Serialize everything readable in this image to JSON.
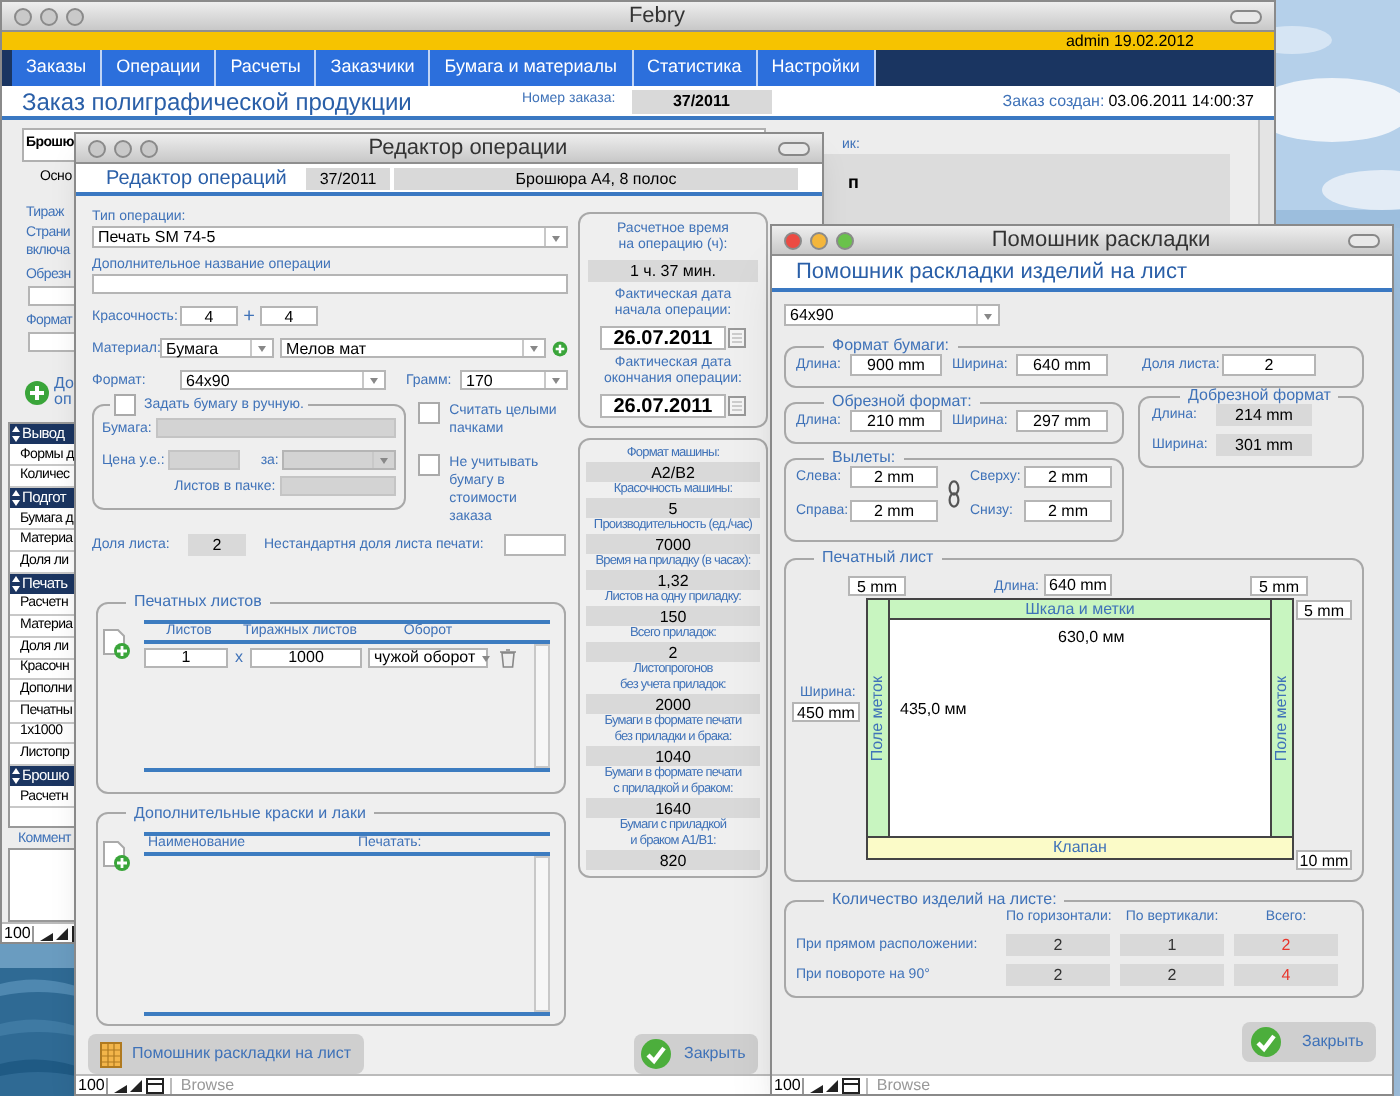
{
  "main_window": {
    "title": "Febry",
    "active": false,
    "user_date": "admin 19.02.2012",
    "nav": [
      {
        "label": "Заказы",
        "selected": false
      },
      {
        "label": "Операции",
        "selected": false
      },
      {
        "label": "Расчеты",
        "selected": false
      },
      {
        "label": "Заказчики",
        "selected": false
      },
      {
        "label": "Бумага и материалы",
        "selected": false
      },
      {
        "label": "Статистика",
        "selected": false
      },
      {
        "label": "Настройки",
        "selected": false
      }
    ],
    "page_title": "Заказ полиграфической продукции",
    "order_label": "Номер заказа:",
    "order_number": "37/2011",
    "created_label": "Заказ создан:",
    "created_value": "03.06.2011 14:00:37",
    "product": "Брошю",
    "tab": "Осно",
    "labels": [
      "Тираж",
      "Страни",
      "включа",
      "Обрезн",
      "Формат"
    ],
    "add_label_lines": [
      "До",
      "оп"
    ],
    "list": [
      {
        "kind": "header",
        "text": "Вывод"
      },
      {
        "kind": "row",
        "text": "Формы д"
      },
      {
        "kind": "row",
        "text": "Количес"
      },
      {
        "kind": "header",
        "text": "Подгот"
      },
      {
        "kind": "row",
        "text": "Бумага д"
      },
      {
        "kind": "row",
        "text": "Материа"
      },
      {
        "kind": "row",
        "text": "Доля ли"
      },
      {
        "kind": "header",
        "text": "Печать"
      },
      {
        "kind": "row",
        "text": "Расчетн"
      },
      {
        "kind": "row",
        "text": "Материа"
      },
      {
        "kind": "row",
        "text": "Доля ли"
      },
      {
        "kind": "row",
        "text": "Красочн"
      },
      {
        "kind": "row",
        "text": "Дополни"
      },
      {
        "kind": "row",
        "text": "Печатны"
      },
      {
        "kind": "row",
        "text": "1x1000"
      },
      {
        "kind": "row",
        "text": "Листопр"
      },
      {
        "kind": "header",
        "text": "Брошю"
      },
      {
        "kind": "row",
        "text": "Расчетн"
      }
    ],
    "comment_label": "Коммент",
    "right_label": "ик:",
    "right_value": "п",
    "zoom": "100"
  },
  "operation_editor": {
    "title": "Редактор операции",
    "active": false,
    "heading": "Редактор операций",
    "order_number": "37/2011",
    "product": "Брошюра А4,  8 полос",
    "operation_type": {
      "label": "Тип операции:",
      "value": "Печать SM 74-5"
    },
    "extra_name": {
      "label": "Дополнительное название операции"
    },
    "colors": {
      "label": "Красочность:",
      "front": "4",
      "plus": "+",
      "back": "4"
    },
    "material": {
      "label": "Материал:",
      "type": "Бумага",
      "value": "Мелов мат"
    },
    "format": {
      "label": "Формат:",
      "value": "64x90"
    },
    "grams": {
      "label": "Грамм:",
      "value": "170"
    },
    "manual_paper": {
      "label": "Задать бумагу в ручную.",
      "checked": false,
      "paper_label": "Бумага:",
      "price_label": "Цена у.е.:",
      "per_label": "за:",
      "pack_label": "Листов в пачке:"
    },
    "options": [
      {
        "label": "Считать целыми пачками",
        "checked": false
      },
      {
        "label": "Не учитывать бумагу в стоимости заказа",
        "checked": false
      }
    ],
    "sheet_share": {
      "label": "Доля листа:",
      "value": "2"
    },
    "custom_share": {
      "label": "Нестандартня доля листа печати:"
    },
    "print_sheets": {
      "title": "Печатных листов",
      "columns": [
        "Листов",
        "Тиражных листов",
        "Оборот"
      ],
      "rows": [
        {
          "sheets": "1",
          "times": "x",
          "run": "1000",
          "turn": "чужой оборот"
        }
      ]
    },
    "extra_inks": {
      "title": "Дополнительные краски и лаки",
      "columns": [
        "Наименование",
        "Печатать:"
      ]
    },
    "timing": [
      {
        "kind": "readout",
        "label": "Расчетное время\nна операцию (ч):",
        "value": "1 ч. 37 мин."
      },
      {
        "kind": "date",
        "label": "Фактическая дата\nначала операции:",
        "value": "26.07.2011"
      },
      {
        "kind": "date",
        "label": "Фактическая дата\nокончания операции:",
        "value": "26.07.2011"
      }
    ],
    "machine": [
      {
        "label": "Формат машины:",
        "value": "A2/B2"
      },
      {
        "label": "Красочность машины:",
        "value": "5"
      },
      {
        "label": "Производительность (ед./час)",
        "value": "7000"
      },
      {
        "label": "Время на приладку (в часах):",
        "value": "1,32"
      },
      {
        "label": "Листов на одну приладку:",
        "value": "150"
      },
      {
        "label": "Всего приладок:",
        "value": "2"
      },
      {
        "label": "Листопрогонов\nбез учета приладок:",
        "value": "2000"
      },
      {
        "label": "Бумаги в формате печати\nбез приладки и брака:",
        "value": "1040"
      },
      {
        "label": "Бумаги в формате печати\nс приладкой и браком:",
        "value": "1640"
      },
      {
        "label": "Бумаги с приладкой\nи браком A1/B1:",
        "value": "820"
      }
    ],
    "layout_button": "Помошник раскладки на лист",
    "close_button": "Закрыть",
    "zoom": "100",
    "mode": "Browse"
  },
  "layout_helper": {
    "title": "Помошник раскладки",
    "active": true,
    "heading": "Помошник раскладки изделий на лист",
    "format": "64x90",
    "paper_format": {
      "title": "Формат бумаги:",
      "length_label": "Длина:",
      "length": "900 mm",
      "width_label": "Ширина:",
      "width": "640 mm",
      "share_label": "Доля листа:",
      "share": "2"
    },
    "trim_format": {
      "title": "Обрезной формат:",
      "length_label": "Длина:",
      "length": "210 mm",
      "width_label": "Ширина:",
      "width": "297 mm"
    },
    "pre_trim_format": {
      "title": "Добрезной формат",
      "length_label": "Длина:",
      "length": "214 mm",
      "width_label": "Ширина:",
      "width": "301 mm"
    },
    "bleeds": {
      "title": "Вылеты:",
      "left_label": "Слева:",
      "left": "2 mm",
      "right_label": "Справа:",
      "right": "2 mm",
      "top_label": "Сверху:",
      "top": "2 mm",
      "bottom_label": "Снизу:",
      "bottom": "2 mm"
    },
    "print_sheet": {
      "title": "Печатный лист",
      "margin_left": "5 mm",
      "length_label": "Длина:",
      "length": "640 mm",
      "margin_right": "5 mm",
      "margin_top": "5 mm",
      "width_label": "Ширина:",
      "width": "450 mm",
      "margin_bottom": "10 mm",
      "top_strip": "Шкала и метки",
      "left_strip": "Поле меток",
      "right_strip": "Поле меток",
      "bottom_strip": "Клапан",
      "area_width": "630,0 мм",
      "area_height": "435,0 мм"
    },
    "count": {
      "title": "Количество изделий на листе:",
      "columns": [
        "По горизонтали:",
        "По вертикали:",
        "Всего:"
      ],
      "rows": [
        {
          "label": "При прямом расположении:",
          "values": [
            "2",
            "1",
            "2"
          ]
        },
        {
          "label": "При повороте на 90°",
          "values": [
            "2",
            "2",
            "4"
          ]
        }
      ]
    },
    "close_button": "Закрыть",
    "zoom": "100",
    "mode": "Browse"
  }
}
